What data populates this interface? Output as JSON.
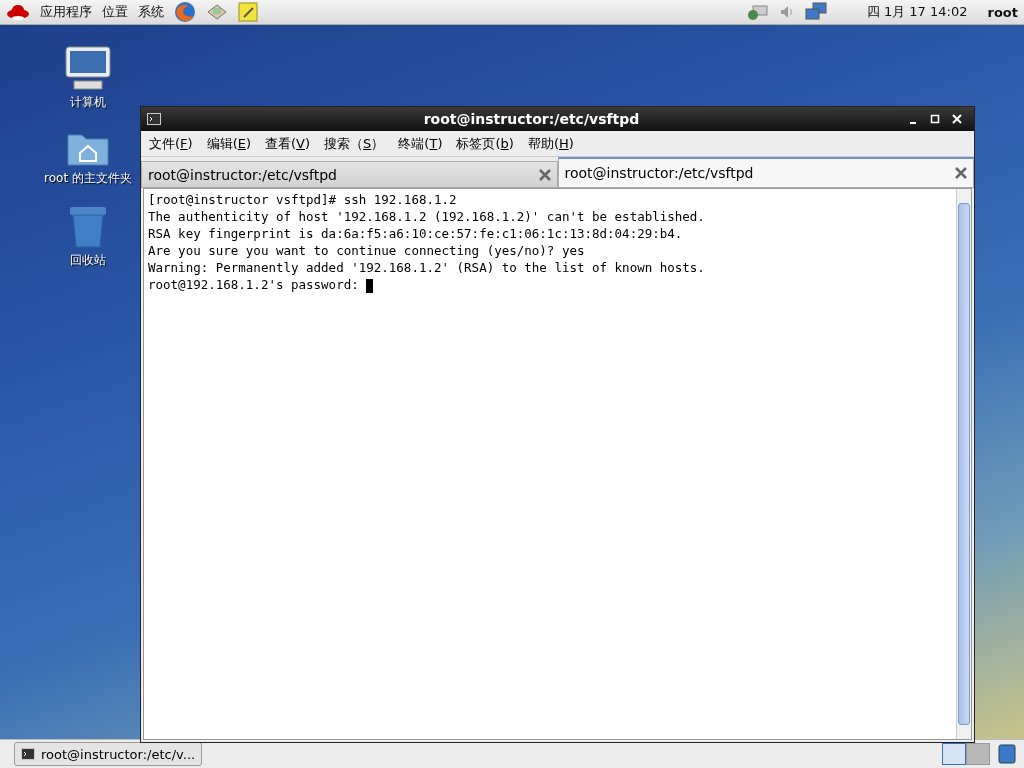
{
  "top_panel": {
    "menus": [
      "应用程序",
      "位置",
      "系统"
    ],
    "clock": "四 1月 17 14:02",
    "user": "root"
  },
  "desktop_icons": [
    {
      "kind": "computer",
      "label": "计算机"
    },
    {
      "kind": "home",
      "label": "root 的主文件夹"
    },
    {
      "kind": "trash",
      "label": "回收站"
    }
  ],
  "window": {
    "title": "root@instructor:/etc/vsftpd",
    "menu": [
      {
        "before": "文件(",
        "key": "F",
        "after": ")"
      },
      {
        "before": "编辑(",
        "key": "E",
        "after": ")"
      },
      {
        "before": "查看(",
        "key": "V",
        "after": ")"
      },
      {
        "before": "搜索（",
        "key": "S",
        "after": "）"
      },
      {
        "before": "终端(",
        "key": "T",
        "after": ")"
      },
      {
        "before": "标签页(",
        "key": "b",
        "after": ")"
      },
      {
        "before": "帮助(",
        "key": "H",
        "after": ")"
      }
    ],
    "tabs": [
      {
        "label": "root@instructor:/etc/vsftpd",
        "selected": false
      },
      {
        "label": "root@instructor:/etc/vsftpd",
        "selected": true
      }
    ],
    "terminal_lines": [
      "[root@instructor vsftpd]# ssh 192.168.1.2",
      "The authenticity of host '192.168.1.2 (192.168.1.2)' can't be established.",
      "RSA key fingerprint is da:6a:f5:a6:10:ce:57:fe:c1:06:1c:13:8d:04:29:b4.",
      "Are you sure you want to continue connecting (yes/no)? yes",
      "Warning: Permanently added '192.168.1.2' (RSA) to the list of known hosts.",
      "root@192.168.1.2's password: "
    ]
  },
  "taskbar": {
    "items": [
      {
        "label": "root@instructor:/etc/v...",
        "selected": false
      }
    ],
    "workspaces": [
      {
        "selected": true
      },
      {
        "selected": false
      }
    ]
  }
}
